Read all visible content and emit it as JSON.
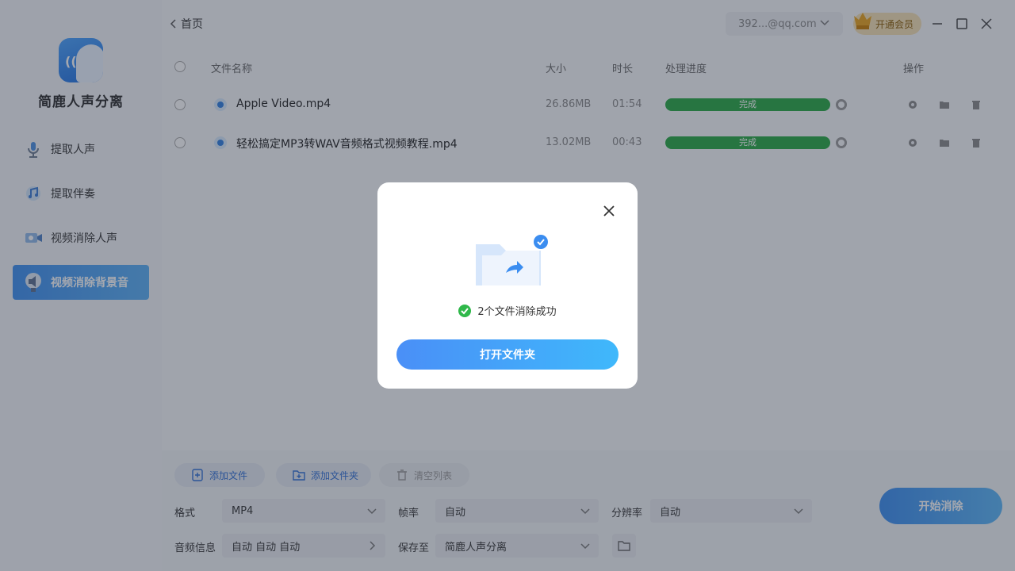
{
  "app": {
    "name": "简鹿人声分离"
  },
  "sidebar": {
    "items": [
      {
        "label": "提取人声",
        "icon": "microphone-icon"
      },
      {
        "label": "提取伴奏",
        "icon": "music-icon"
      },
      {
        "label": "视频消除人声",
        "icon": "video-icon"
      },
      {
        "label": "视频消除背景音",
        "icon": "speaker-icon",
        "active": true
      }
    ]
  },
  "header": {
    "back_label": "首页",
    "account": "392...@qq.com",
    "vip_label": "开通会员"
  },
  "table": {
    "columns": [
      "文件名称",
      "大小",
      "时长",
      "处理进度",
      "操作"
    ],
    "rows": [
      {
        "name": "Apple Video.mp4",
        "size": "26.86MB",
        "duration": "01:54",
        "status": "完成",
        "progress": 1.0
      },
      {
        "name": "轻松搞定MP3转WAV音频格式视频教程.mp4",
        "size": "13.02MB",
        "duration": "00:43",
        "status": "完成",
        "progress": 1.0
      }
    ]
  },
  "bottom": {
    "add_file": "添加文件",
    "add_folder": "添加文件夹",
    "clear_list": "清空列表",
    "format_label": "格式",
    "format_value": "MP4",
    "framerate_label": "帧率",
    "framerate_value": "自动",
    "resolution_label": "分辨率",
    "resolution_value": "自动",
    "audio_label": "音频信息",
    "audio_value": "自动 自动 自动",
    "saveto_label": "保存至",
    "saveto_value": "简鹿人声分离",
    "start_label": "开始消除"
  },
  "dialog": {
    "message": "2个文件消除成功",
    "button": "打开文件夹"
  },
  "colors": {
    "accent": "#3d8ff0",
    "success": "#26a843"
  }
}
